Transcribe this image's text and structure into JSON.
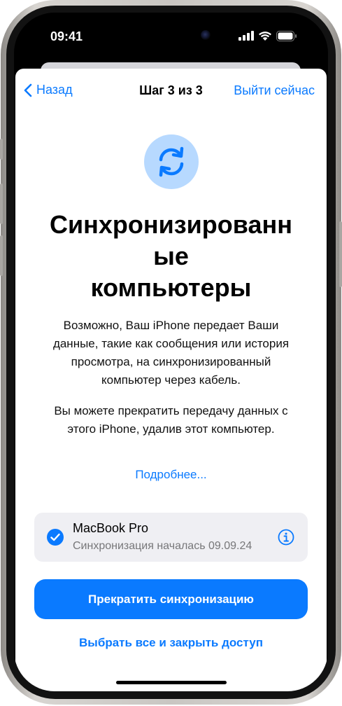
{
  "status_bar": {
    "time": "09:41",
    "icons": [
      "signal-icon",
      "wifi-icon",
      "battery-icon"
    ]
  },
  "nav": {
    "back_label": "Назад",
    "title": "Шаг 3 из 3",
    "exit_label": "Выйти сейчас"
  },
  "content": {
    "icon": "sync-icon",
    "heading_lines": [
      "Синхронизированн",
      "ые",
      "компьютеры"
    ],
    "paragraph_1_lines": [
      "Возможно, Ваш iPhone передает Ваши",
      "данные, такие как сообщения или история",
      "просмотра, на синхронизированный",
      "компьютер через кабель."
    ],
    "paragraph_2_lines": [
      "Вы можете прекратить передачу данных с",
      "этого iPhone, удалив этот компьютер."
    ],
    "more_link": "Подробнее..."
  },
  "device": {
    "name": "MacBook Pro",
    "subtitle": "Синхронизация началась 09.09.24",
    "selected": true
  },
  "actions": {
    "primary_label": "Прекратить синхронизацию",
    "secondary_label": "Выбрать все и закрыть доступ"
  },
  "colors": {
    "accent": "#0a7aff",
    "icon_bg": "#b7d9ff",
    "card_bg": "#efeff3"
  }
}
